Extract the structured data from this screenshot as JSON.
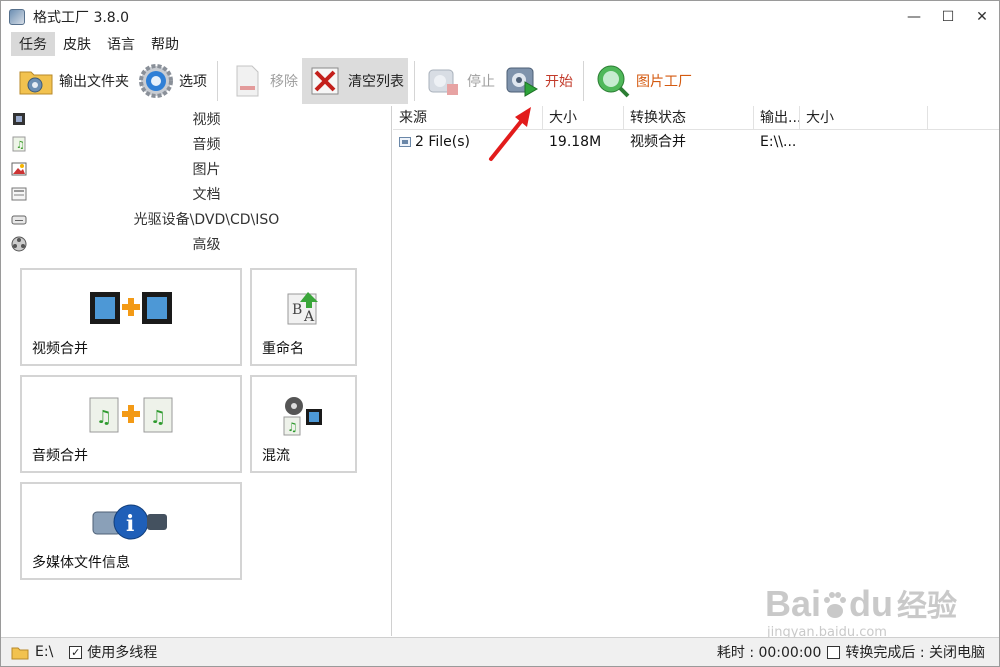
{
  "window": {
    "title": "格式工厂 3.8.0",
    "minimize": "—",
    "maximize": "☐",
    "close": "✕"
  },
  "menu": {
    "items": [
      "任务",
      "皮肤",
      "语言",
      "帮助"
    ]
  },
  "toolbar": {
    "output_folder": "输出文件夹",
    "options": "选项",
    "remove": "移除",
    "clear_list": "清空列表",
    "stop": "停止",
    "start": "开始",
    "picture_factory": "图片工厂"
  },
  "categories": [
    "视频",
    "音频",
    "图片",
    "文档",
    "光驱设备\\DVD\\CD\\ISO",
    "高级"
  ],
  "tiles": {
    "video_merge": "视频合并",
    "rename": "重命名",
    "audio_merge": "音频合并",
    "mux": "混流",
    "media_info": "多媒体文件信息"
  },
  "list": {
    "headers": [
      "来源",
      "大小",
      "转换状态",
      "输出...",
      "大小"
    ],
    "rows": [
      {
        "source": "2 File(s)",
        "size": "19.18M",
        "status": "视频合并",
        "output": "E:\\\\..."
      }
    ]
  },
  "status": {
    "drive": "E:\\",
    "multithread_label": "使用多线程",
    "multithread_checked": true,
    "elapsed": "耗时 : 00:00:00",
    "after_convert": "转换完成后 : 关闭电脑",
    "after_convert_checked": false
  },
  "watermark": {
    "brand": "Bai",
    "brand2": "du",
    "cn": "经验",
    "url": "jingyan.baidu.com"
  },
  "colors": {
    "start_text": "#c23a2a",
    "picture_factory_text": "#d45a10",
    "arrow": "#e21b1b"
  }
}
